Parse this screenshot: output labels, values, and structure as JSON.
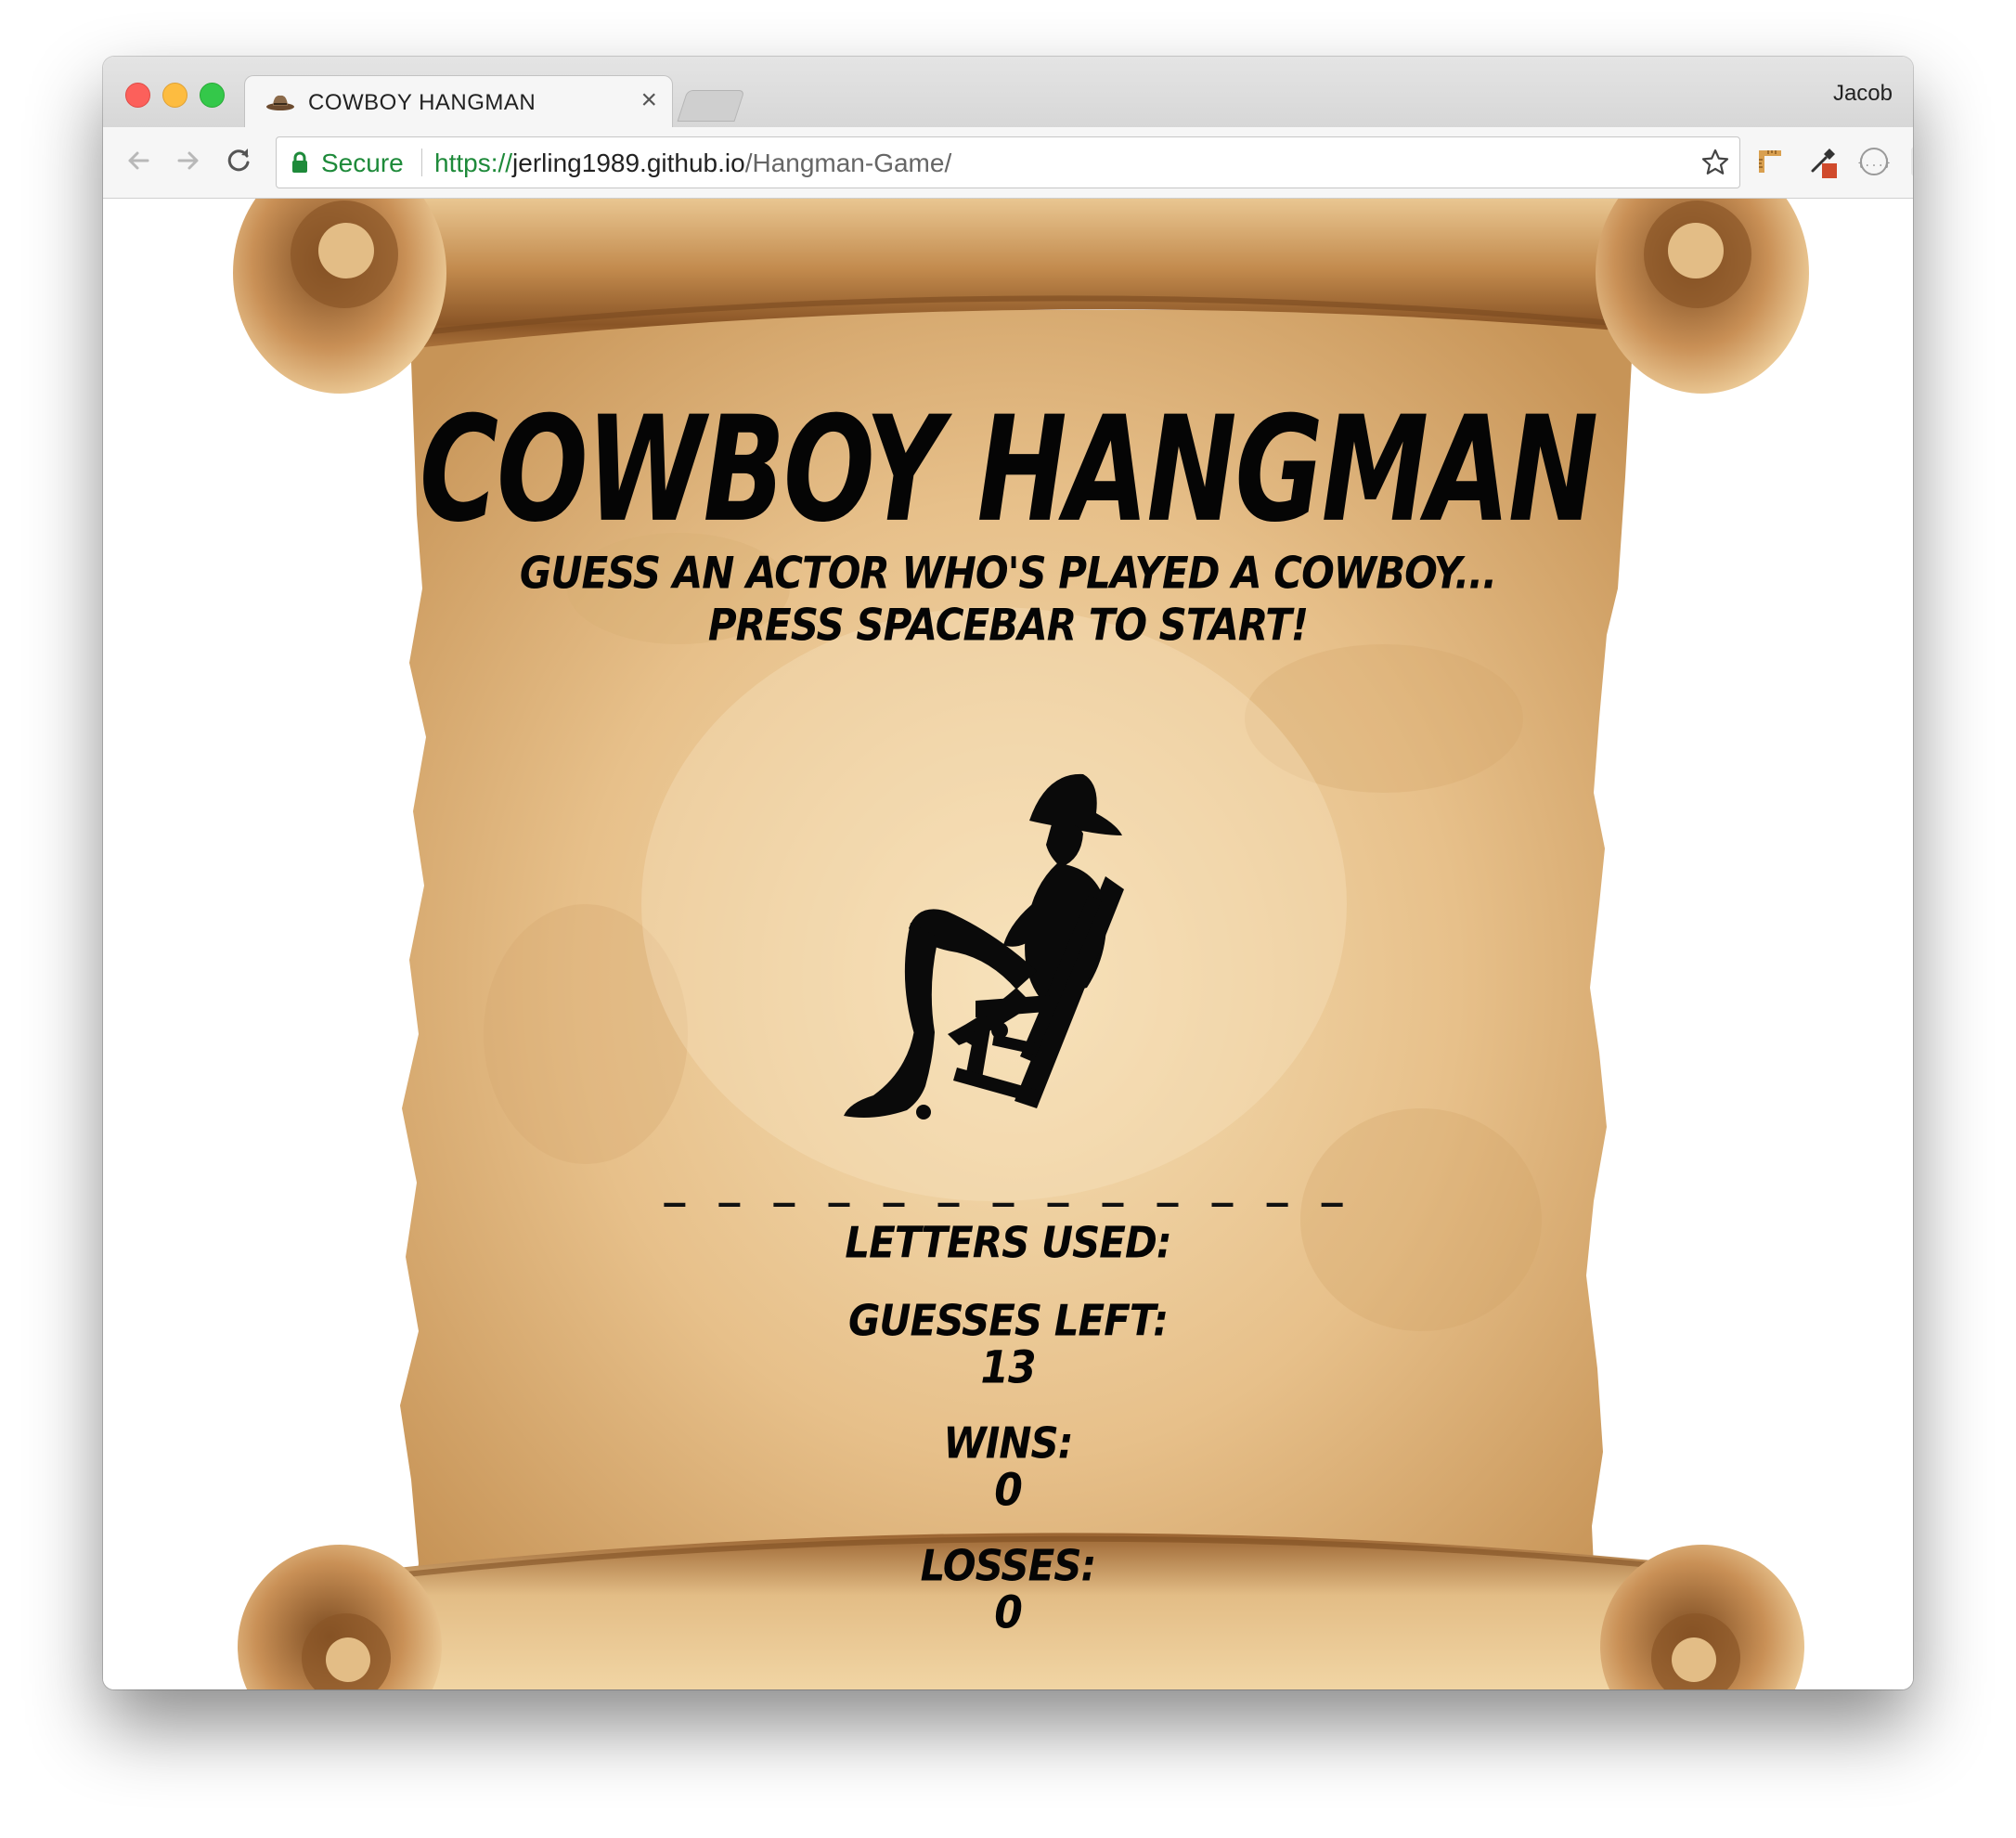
{
  "browser": {
    "tab_title": "COWBOY HANGMAN",
    "tab_close": "×",
    "profile_name": "Jacob",
    "secure_label": "Secure",
    "url_scheme": "https://",
    "url_host": "jerling1989.github.io",
    "url_path": "/Hangman-Game/",
    "icons": {
      "back": "arrow-left-icon",
      "forward": "arrow-right-icon",
      "reload": "reload-icon",
      "secure": "lock-icon",
      "bookmark": "star-icon",
      "extensions": [
        "ruler-extension-icon",
        "eyedropper-extension-icon",
        "json-extension-icon",
        "react-devtools-icon",
        "menu-kebab-icon"
      ]
    }
  },
  "game": {
    "title": "COWBOY HANGMAN",
    "tagline_line1": "GUESS AN ACTOR WHO'S PLAYED A COWBOY...",
    "tagline_line2": "PRESS SPACEBAR TO START!",
    "illustration": "cowboy-in-rocking-chair-silhouette",
    "word_blanks": "_ _ _ _ _ _ _ _ _ _ _ _ _",
    "letters_used_label": "LETTERS USED:",
    "letters_used_value": "",
    "guesses_left_label": "GUESSES LEFT:",
    "guesses_left_value": "13",
    "wins_label": "WINS:",
    "wins_value": "0",
    "losses_label": "LOSSES:",
    "losses_value": "0"
  },
  "colors": {
    "parchment_light": "#f4dcb0",
    "parchment_dark": "#8a5a2b",
    "text": "#050505",
    "secure_green": "#1e8a3a"
  }
}
